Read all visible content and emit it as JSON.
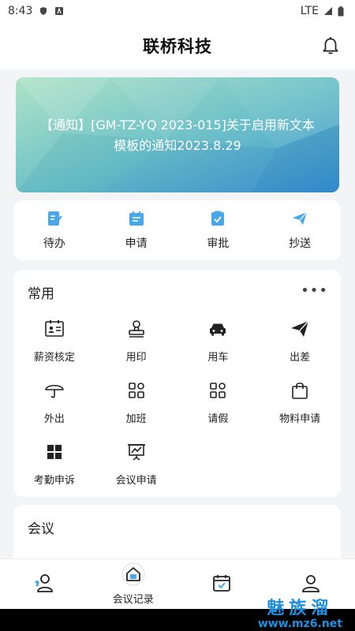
{
  "status_bar": {
    "time": "8:43",
    "network": "LTE"
  },
  "header": {
    "title": "联桥科技"
  },
  "banner": {
    "text": "【通知】[GM-TZ-YQ 2023-015]关于启用新文本模板的通知2023.8.29"
  },
  "quick_actions": [
    {
      "label": "待办",
      "icon": "todo-icon"
    },
    {
      "label": "申请",
      "icon": "apply-icon"
    },
    {
      "label": "审批",
      "icon": "approve-icon"
    },
    {
      "label": "抄送",
      "icon": "send-icon"
    }
  ],
  "common": {
    "title": "常用",
    "more": "•••",
    "items": [
      {
        "label": "薪资核定",
        "icon": "salary-icon"
      },
      {
        "label": "用印",
        "icon": "stamp-icon"
      },
      {
        "label": "用车",
        "icon": "car-icon"
      },
      {
        "label": "出差",
        "icon": "paper-plane-icon"
      },
      {
        "label": "外出",
        "icon": "umbrella-icon"
      },
      {
        "label": "加班",
        "icon": "overtime-icon"
      },
      {
        "label": "请假",
        "icon": "leave-icon"
      },
      {
        "label": "物料申请",
        "icon": "bag-icon"
      },
      {
        "label": "考勤申诉",
        "icon": "grid-icon"
      },
      {
        "label": "会议申请",
        "icon": "presentation-icon"
      }
    ]
  },
  "meeting": {
    "title": "会议"
  },
  "tabbar": {
    "tabs": [
      {
        "label": "",
        "icon": "contacts-icon"
      },
      {
        "label": "会议记录",
        "icon": "home-icon"
      },
      {
        "label": "",
        "icon": "calendar-icon"
      },
      {
        "label": "",
        "icon": "profile-icon"
      }
    ]
  },
  "watermark": {
    "line1": "魅族溜",
    "line2": "www.mz6.net"
  },
  "colors": {
    "accent": "#4aa8e8",
    "banner_start": "#a8e0c4",
    "banner_end": "#3d97d4"
  }
}
